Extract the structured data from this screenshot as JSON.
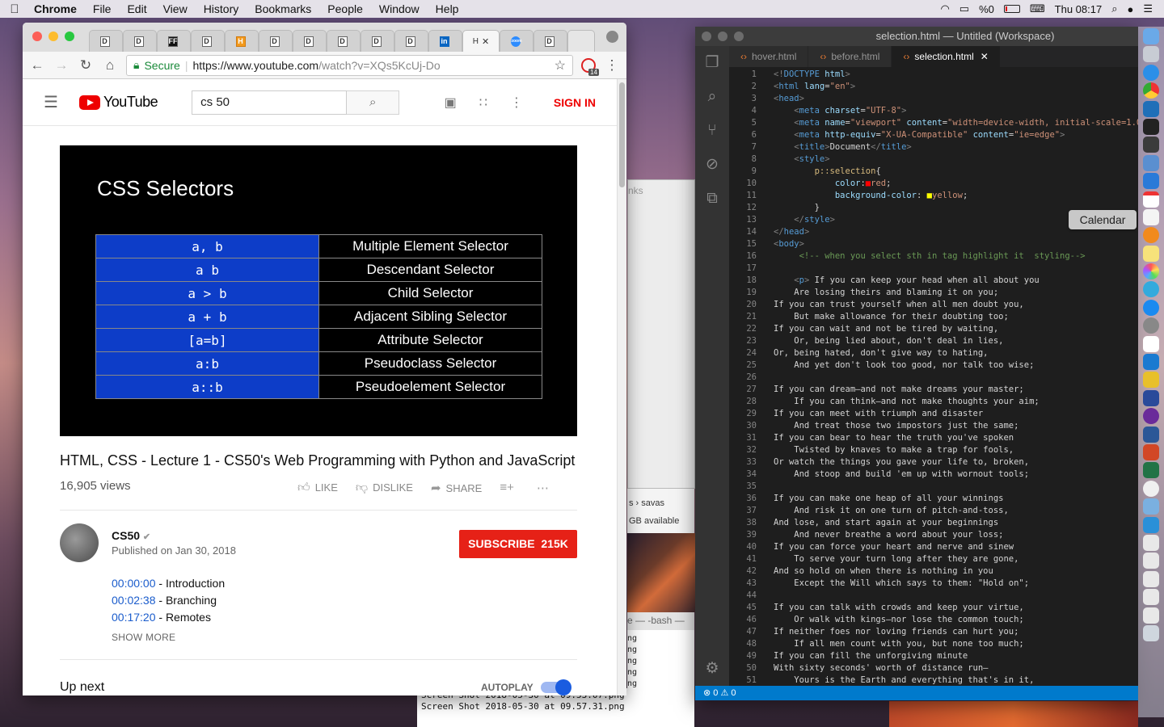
{
  "menubar": {
    "app": "Chrome",
    "items": [
      "File",
      "Edit",
      "View",
      "History",
      "Bookmarks",
      "People",
      "Window",
      "Help"
    ],
    "battery": "%0",
    "clock": "Thu 08:17"
  },
  "chrome": {
    "active_tab_label": "H",
    "tab_favicons": [
      "D",
      "D",
      "FF",
      "D",
      "H",
      "D",
      "D",
      "D",
      "D",
      "D",
      "in",
      "",
      "zoom",
      "D"
    ],
    "secure_label": "Secure",
    "url_host": "https://www.youtube.com",
    "url_path": "/watch?v=XQs5KcUj-Do",
    "ext_badge": "14"
  },
  "youtube": {
    "logo_text": "YouTube",
    "search_value": "cs 50",
    "sign_in": "SIGN IN",
    "slide": {
      "title": "CSS Selectors",
      "rows": [
        {
          "code": "a, b",
          "desc": "Multiple Element Selector"
        },
        {
          "code": "a b",
          "desc": "Descendant Selector"
        },
        {
          "code": "a > b",
          "desc": "Child Selector"
        },
        {
          "code": "a + b",
          "desc": "Adjacent Sibling Selector"
        },
        {
          "code": "[a=b]",
          "desc": "Attribute Selector"
        },
        {
          "code": "a:b",
          "desc": "Pseudoclass Selector"
        },
        {
          "code": "a::b",
          "desc": "Pseudoelement Selector"
        }
      ]
    },
    "video_title": "HTML, CSS - Lecture 1 - CS50's Web Programming with Python and JavaScript",
    "views": "16,905 views",
    "like": "LIKE",
    "dislike": "DISLIKE",
    "share": "SHARE",
    "channel": "CS50",
    "published": "Published on Jan 30, 2018",
    "subscribe": "SUBSCRIBE",
    "subscribers": "215K",
    "chapters": [
      {
        "time": "00:00:00",
        "label": " - Introduction"
      },
      {
        "time": "00:02:38",
        "label": " - Branching"
      },
      {
        "time": "00:17:20",
        "label": " - Remotes"
      }
    ],
    "show_more": "SHOW MORE",
    "up_next": "Up next",
    "autoplay": "AUTOPLAY"
  },
  "vscode": {
    "title": "selection.html — Untitled (Workspace)",
    "tabs": [
      "hover.html",
      "before.html",
      "selection.html"
    ],
    "status_errors": "0",
    "status_warnings": "0"
  },
  "background": {
    "terminal_lines": [
      "Screen Shot 2018-05-30 at 09.53.07.png",
      "Screen Shot 2018-05-30 at 09.57.31.png"
    ],
    "term2_title": "e — -bash —",
    "finder_path": "s › savas",
    "finder_status": "GB available",
    "links_fragment": "nks"
  },
  "calendar_tooltip": "Calendar"
}
